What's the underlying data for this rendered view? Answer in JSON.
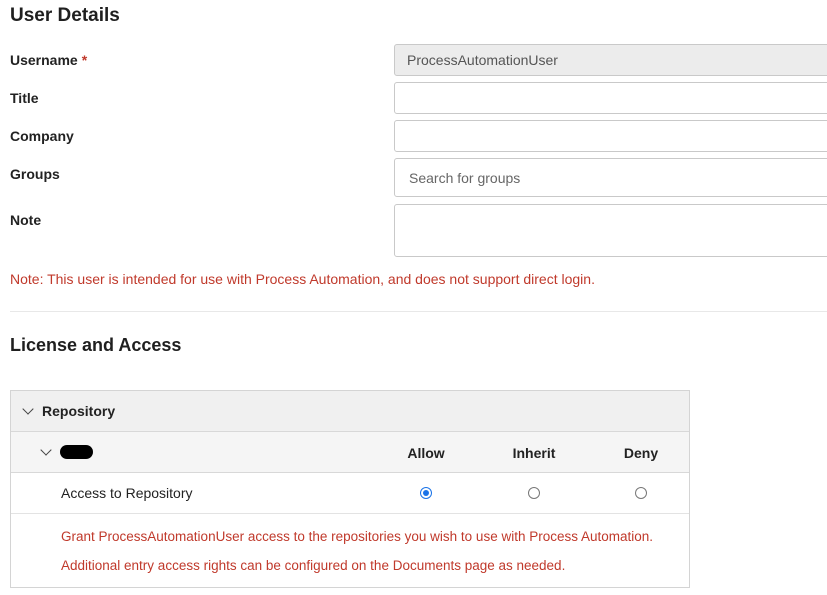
{
  "user_details": {
    "heading": "User Details",
    "username_label": "Username",
    "required_mark": "*",
    "username_value": "ProcessAutomationUser",
    "title_label": "Title",
    "title_value": "",
    "company_label": "Company",
    "company_value": "",
    "groups_label": "Groups",
    "groups_placeholder": "Search for groups",
    "note_label": "Note",
    "note_value": "",
    "warning": "Note: This user is intended for use with Process Automation, and does not support direct login."
  },
  "license": {
    "heading": "License and Access",
    "repository_label": "Repository",
    "columns": [
      "Allow",
      "Inherit",
      "Deny"
    ],
    "access_label": "Access to Repository",
    "selected_option": "Allow",
    "info_lines": [
      "Grant ProcessAutomationUser access to the repositories you wish to use with Process Automation.",
      "Additional entry access rights can be configured on the Documents page as needed."
    ]
  },
  "colors": {
    "accent": "#1a73e8",
    "warning": "#c0392b"
  }
}
